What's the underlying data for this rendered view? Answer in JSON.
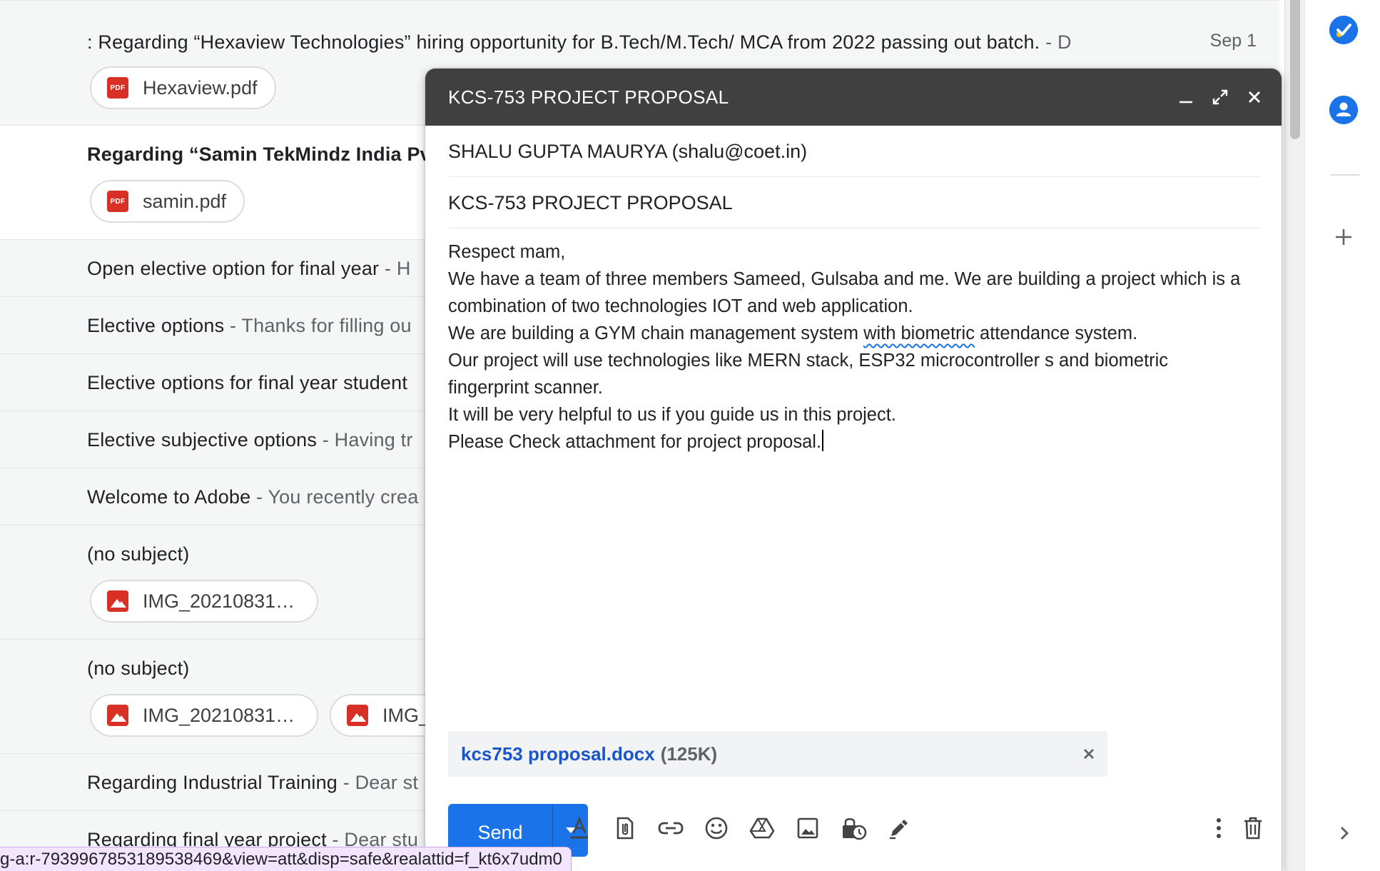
{
  "inbox": {
    "rows": [
      {
        "subject": ": Regarding “Hexaview Technologies” hiring opportunity for B.Tech/M.Tech/ MCA from 2022 passing out batch.",
        "snippet": " - D",
        "date": "Sep 1",
        "attachments": [
          "Hexaview.pdf"
        ]
      },
      {
        "subject": "Regarding “Samin TekMindz India Pv",
        "snippet": "",
        "attachments": [
          "samin.pdf"
        ]
      },
      {
        "subject": "Open elective option for final year",
        "snippet": " - H"
      },
      {
        "subject": "Elective options",
        "snippet": " - Thanks for filling ou"
      },
      {
        "subject": "Elective options for final year student",
        "snippet": ""
      },
      {
        "subject": "Elective subjective options",
        "snippet": " - Having tr"
      },
      {
        "subject": "Welcome to Adobe",
        "snippet": " - You recently crea"
      },
      {
        "subject": "(no subject)",
        "snippet": "",
        "attachments": [
          "IMG_20210831…"
        ]
      },
      {
        "subject": "(no subject)",
        "snippet": "",
        "attachments": [
          "IMG_20210831…",
          "IMG_"
        ]
      },
      {
        "subject": "Regarding Industrial Training",
        "snippet": " - Dear st"
      },
      {
        "subject": "Regarding final year project",
        "snippet": " - Dear stu"
      }
    ],
    "attachment_type_label": "PDF"
  },
  "compose": {
    "title": "KCS-753 PROJECT PROPOSAL",
    "to": "SHALU GUPTA MAURYA (shalu@coet.in)",
    "subject": "KCS-753 PROJECT PROPOSAL",
    "body": {
      "line1": "Respect mam,",
      "line2": "We have a team of three members Sameed, Gulsaba and me. We are building a project which is a",
      "line3": "combination of two technologies IOT and web application.",
      "line4_a": "We are building a GYM chain management system ",
      "line4_b": "with biometric",
      "line4_c": " attendance system.",
      "line5": "Our project will use technologies like MERN stack, ESP32 microcontroller s and biometric",
      "line6": "fingerprint scanner.",
      "line7": "It will be very helpful to us if you guide us in this project.",
      "line8": "Please Check attachment for project proposal."
    },
    "attachment": {
      "name": "kcs753 proposal.docx",
      "size": "(125K)"
    },
    "send_label": "Send"
  },
  "status_url": "g-a:r-7939967853189538469&view=att&disp=safe&realattid=f_kt6x7udm0",
  "colors": {
    "accent": "#1a73e8",
    "header": "#404040",
    "file_icon": "#d93025",
    "link": "#1a55c9"
  }
}
